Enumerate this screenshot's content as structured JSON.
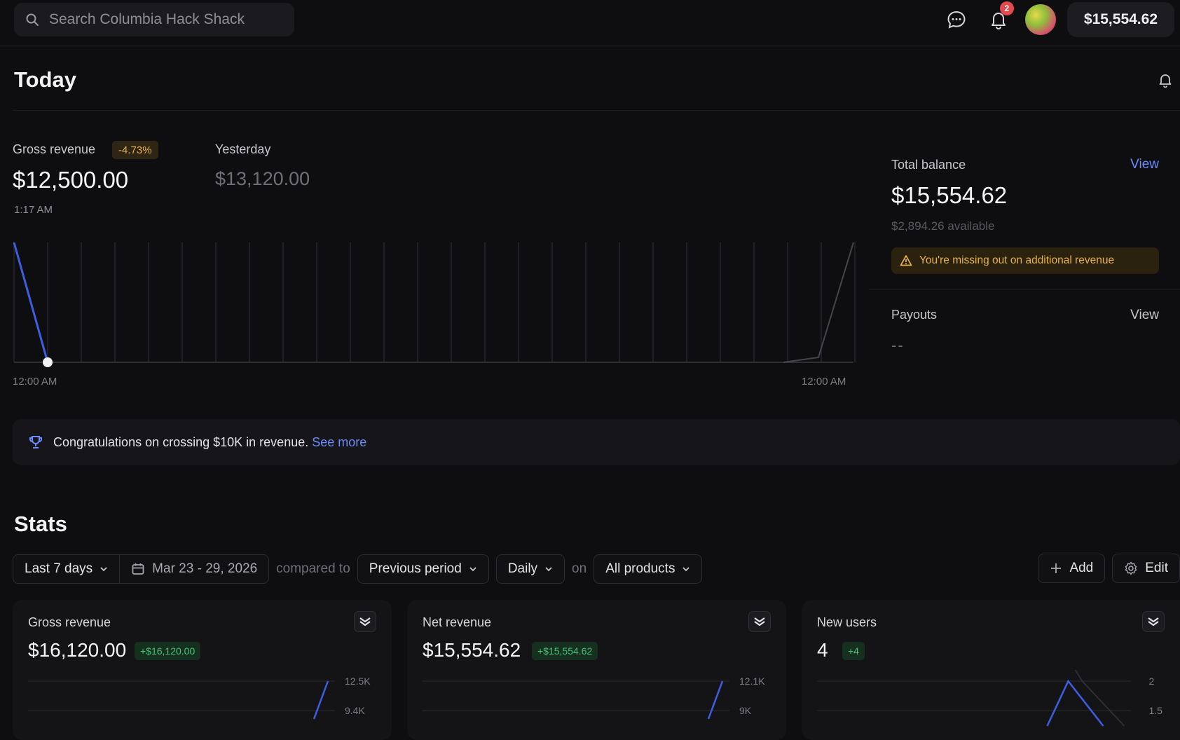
{
  "topbar": {
    "search_placeholder": "Search Columbia Hack Shack",
    "notification_count": "2",
    "balance": "$15,554.62"
  },
  "today": {
    "title": "Today",
    "gross_revenue_label": "Gross revenue",
    "gross_revenue_delta": "-4.73%",
    "gross_revenue_value": "$12,500.00",
    "time": "1:17 AM",
    "yesterday_label": "Yesterday",
    "yesterday_value": "$13,120.00",
    "axis_start": "12:00 AM",
    "axis_end": "12:00 AM"
  },
  "balance_panel": {
    "total_balance_label": "Total balance",
    "total_balance_view": "View",
    "total_balance_value": "$15,554.62",
    "available": "$2,894.26 available",
    "alert": "You're missing out on additional revenue",
    "payouts_label": "Payouts",
    "payouts_view": "View",
    "payouts_value": "--"
  },
  "congrats": {
    "text": "Congratulations on crossing $10K in revenue.",
    "link": "See more"
  },
  "stats": {
    "title": "Stats",
    "range": "Last 7 days",
    "dates": "Mar 23 - 29, 2026",
    "compared_to": "compared to",
    "comparison": "Previous period",
    "interval": "Daily",
    "on": "on",
    "products": "All products",
    "add": "Add",
    "edit": "Edit",
    "cards": [
      {
        "title": "Gross revenue",
        "value": "$16,120.00",
        "delta": "+$16,120.00",
        "tick_top": "12.5K",
        "tick_bottom": "9.4K"
      },
      {
        "title": "Net revenue",
        "value": "$15,554.62",
        "delta": "+$15,554.62",
        "tick_top": "12.1K",
        "tick_bottom": "9K"
      },
      {
        "title": "New users",
        "value": "4",
        "delta": "+4",
        "tick_top": "2",
        "tick_bottom": "1.5"
      }
    ]
  },
  "colors": {
    "accent": "#6b8cff",
    "series": "#3d5ee0",
    "warning": "#e8b24a",
    "positive": "#46c37b",
    "notification": "#e5484d"
  }
}
